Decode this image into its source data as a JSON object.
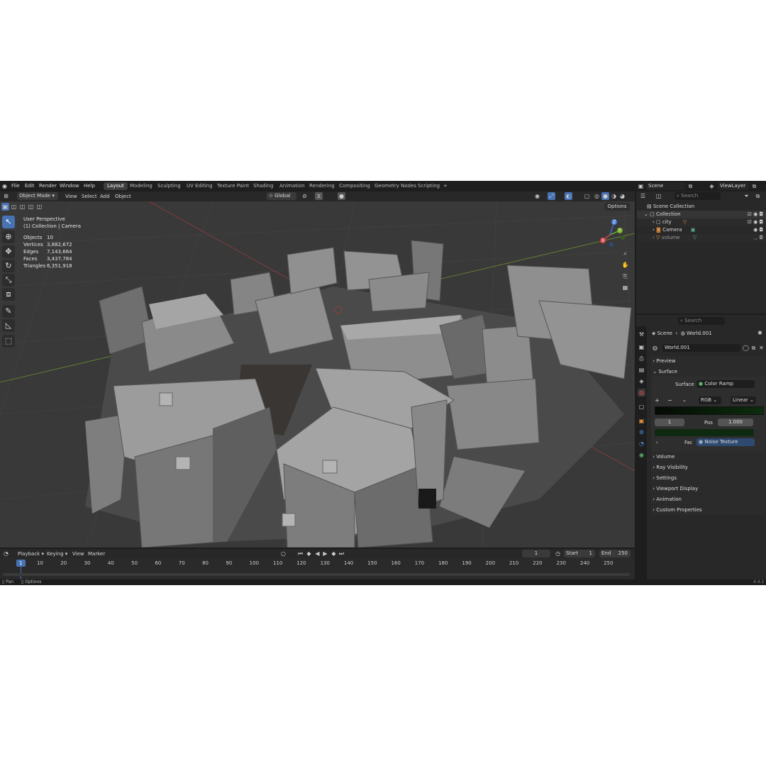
{
  "menus": {
    "file": "File",
    "edit": "Edit",
    "render": "Render",
    "window": "Window",
    "help": "Help"
  },
  "workspaces": [
    "Layout",
    "Modeling",
    "Sculpting",
    "UV Editing",
    "Texture Paint",
    "Shading",
    "Animation",
    "Rendering",
    "Compositing",
    "Geometry Nodes",
    "Scripting"
  ],
  "add_workspace": "+",
  "scene": {
    "name": "Scene",
    "view_layer": "ViewLayer"
  },
  "viewport_header": {
    "mode": "Object Mode",
    "view": "View",
    "select": "Select",
    "add": "Add",
    "object": "Object",
    "orientation": "Global",
    "options": "Options"
  },
  "overlay": {
    "perspective": "User Perspective",
    "collection": "(1) Collection | Camera"
  },
  "stats": [
    {
      "label": "Objects",
      "value": "10"
    },
    {
      "label": "Vertices",
      "value": "3,882,672"
    },
    {
      "label": "Edges",
      "value": "7,143,664"
    },
    {
      "label": "Faces",
      "value": "3,437,784"
    },
    {
      "label": "Triangles",
      "value": "6,351,918"
    }
  ],
  "gizmo": {
    "x": "X",
    "y": "Y",
    "z": "Z"
  },
  "outliner": {
    "search_placeholder": "Search",
    "scene_collection": "Scene Collection",
    "items": [
      {
        "name": "Collection"
      },
      {
        "name": "city"
      },
      {
        "name": "Camera"
      },
      {
        "name": "volume"
      }
    ]
  },
  "properties": {
    "search_placeholder": "Search",
    "breadcrumb_scene": "Scene",
    "breadcrumb_world": "World.001",
    "world_name": "World.001",
    "sections": {
      "preview": "Preview",
      "surface": "Surface",
      "volume": "Volume",
      "ray_visibility": "Ray Visibility",
      "settings": "Settings",
      "viewport_display": "Viewport Display",
      "animation": "Animation",
      "custom_properties": "Custom Properties"
    },
    "surface_label": "Surface",
    "surface_value": "Color Ramp",
    "color_mode": "RGB",
    "interpolation": "Linear",
    "stop_index": "1",
    "pos_label": "Pos",
    "pos_value": "1.000",
    "fac_label": "Fac",
    "fac_value": "Noise Texture",
    "add": "+",
    "remove": "−"
  },
  "timeline": {
    "playback": "Playback",
    "keying": "Keying",
    "view": "View",
    "marker": "Marker",
    "current_frame": "1",
    "start_label": "Start",
    "start": "1",
    "end_label": "End",
    "end": "250",
    "ticks": [
      "1",
      "10",
      "20",
      "30",
      "40",
      "50",
      "60",
      "70",
      "80",
      "90",
      "100",
      "110",
      "120",
      "130",
      "140",
      "150",
      "160",
      "170",
      "180",
      "190",
      "200",
      "210",
      "220",
      "230",
      "240",
      "250"
    ]
  },
  "status": {
    "pan": "Pan",
    "options": "Options",
    "version": "4.4.1"
  },
  "colors": {
    "accent": "#4772b3",
    "bg": "#1d1d1d",
    "viewport": "#393939",
    "panel": "#2b2b2b"
  }
}
